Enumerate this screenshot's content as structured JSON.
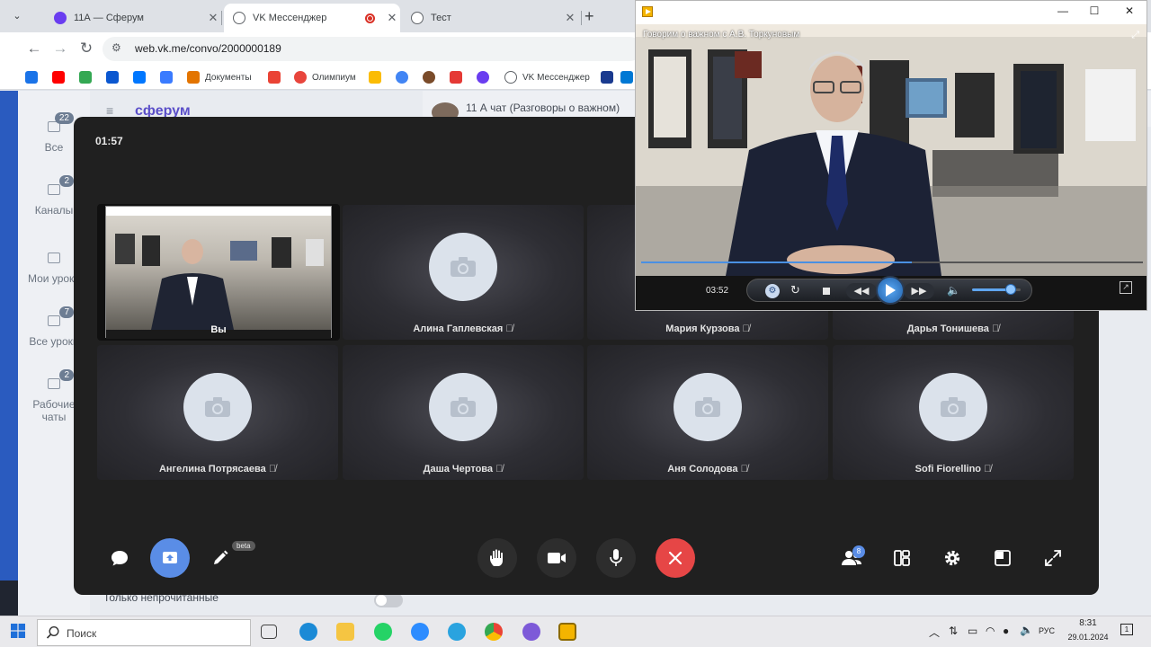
{
  "browser": {
    "tabs": [
      {
        "label": "11А — Сферум",
        "icon_color": "#6a3df0",
        "active": false
      },
      {
        "label": "VK Мессенджер",
        "icon_color": "#5f6368",
        "active": true,
        "recording": true
      },
      {
        "label": "Тест",
        "icon_color": "#5f6368",
        "active": false
      }
    ],
    "new_tab_label": "+",
    "url": "web.vk.me/convo/2000000189",
    "bookmarks": [
      {
        "label": "",
        "color": "#1a73e8"
      },
      {
        "label": "",
        "color": "#ff0000"
      },
      {
        "label": "",
        "color": "#34a853"
      },
      {
        "label": "",
        "color": "#0b57d0"
      },
      {
        "label": "",
        "color": "#0077ff"
      },
      {
        "label": "",
        "color": "#3a7bff"
      },
      {
        "label": "Документы",
        "color": "#e37400"
      },
      {
        "label": "",
        "color": "#ea4335"
      },
      {
        "label": "Олимпиум",
        "color": "#e8453c"
      },
      {
        "label": "",
        "color": "#fbbc04"
      },
      {
        "label": "",
        "color": "#4285f4"
      },
      {
        "label": "",
        "color": "#7a4b2a"
      },
      {
        "label": "",
        "color": "#e53935"
      },
      {
        "label": "",
        "color": "#6a3df0"
      },
      {
        "label": "VK Мессенджер",
        "color": "#5f6368"
      },
      {
        "label": "",
        "color": "#1a3a8f"
      },
      {
        "label": "",
        "color": "#0078d4"
      }
    ]
  },
  "background_app": {
    "logo": "сферум",
    "nav": [
      {
        "label": "Все",
        "badge": "22"
      },
      {
        "label": "Каналы",
        "badge": "2"
      },
      {
        "label": "Мои уроки",
        "badge": ""
      },
      {
        "label": "Все уроки",
        "badge": "7"
      },
      {
        "label": "Рабочие чаты",
        "badge": "2"
      }
    ],
    "chat_title": "11 А чат (Разговоры о важном)",
    "unread_only_label": "Только непрочитанные"
  },
  "call": {
    "timer": "01:57",
    "self_label": "Вы",
    "participants": [
      {
        "name": "Алина Гаплевская"
      },
      {
        "name": "Мария Курзова"
      },
      {
        "name": "Дарья Тонишева"
      },
      {
        "name": "Ангелина Потрясаева"
      },
      {
        "name": "Даша Чертова"
      },
      {
        "name": "Аня Солодова"
      },
      {
        "name": "Sofi Fiorellino"
      }
    ],
    "beta_label": "beta",
    "participants_count": "8",
    "accent_color": "#5a8de6",
    "end_call_color": "#e64646"
  },
  "player": {
    "video_title": "Говорим о важном с А.В. Торкуновым",
    "time": "03:52",
    "volume_level": 0.8,
    "progress": 0.54
  },
  "taskbar": {
    "search_placeholder": "Поиск",
    "language": "РУС",
    "time": "8:31",
    "date": "29.01.2024"
  }
}
